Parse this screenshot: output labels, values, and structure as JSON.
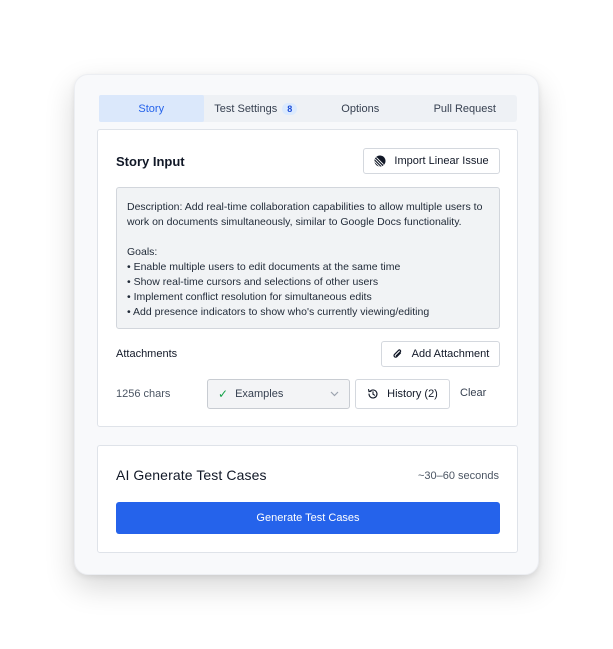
{
  "tabs": [
    {
      "label": "Story",
      "active": true
    },
    {
      "label": "Test Settings",
      "badge": "8"
    },
    {
      "label": "Options"
    },
    {
      "label": "Pull Request"
    }
  ],
  "story": {
    "title": "Story Input",
    "import_label": "Import Linear Issue",
    "text": "Description: Add real-time collaboration capabilities to allow multiple users to work on documents simultaneously, similar to Google Docs functionality.\n\nGoals:\n• Enable multiple users to edit documents at the same time\n• Show real-time cursors and selections of other users\n• Implement conflict resolution for simultaneous edits\n• Add presence indicators to show who's currently viewing/editing",
    "attachments_label": "Attachments",
    "add_attachment_label": "Add Attachment",
    "char_count": "1256 chars",
    "examples_label": "Examples",
    "history_label": "History (2)",
    "clear_label": "Clear"
  },
  "generate": {
    "title": "AI Generate Test Cases",
    "eta": "~30–60 seconds",
    "button_label": "Generate Test Cases"
  },
  "colors": {
    "accent": "#2563eb",
    "active_tab_bg": "#dbe8fb",
    "check": "#16a34a"
  },
  "icons": [
    "linear-icon",
    "paperclip-icon",
    "check-icon",
    "chevron-down-icon",
    "history-icon"
  ]
}
